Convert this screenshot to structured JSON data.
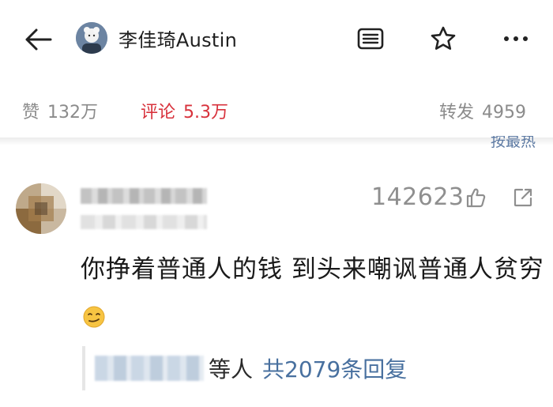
{
  "header": {
    "user_name": "李佳琦Austin",
    "icons": [
      "back-arrow-icon",
      "menu-list-icon",
      "star-icon",
      "more-dots-icon"
    ]
  },
  "stats": {
    "likes_label": "赞",
    "likes_value": "132万",
    "comments_label": "评论",
    "comments_value": "5.3万",
    "reposts_label": "转发",
    "reposts_value": "4959",
    "active_color": "#d8323c"
  },
  "sort": {
    "label": "按最热"
  },
  "comment": {
    "like_count": "142623",
    "text": "你挣着普通人的钱 到头来嘲讽普通人贫穷",
    "emoji": "smirk-emoji",
    "reply": {
      "others_label": "等人",
      "total_label": "共2079条回复",
      "link_color": "#48709f"
    }
  }
}
